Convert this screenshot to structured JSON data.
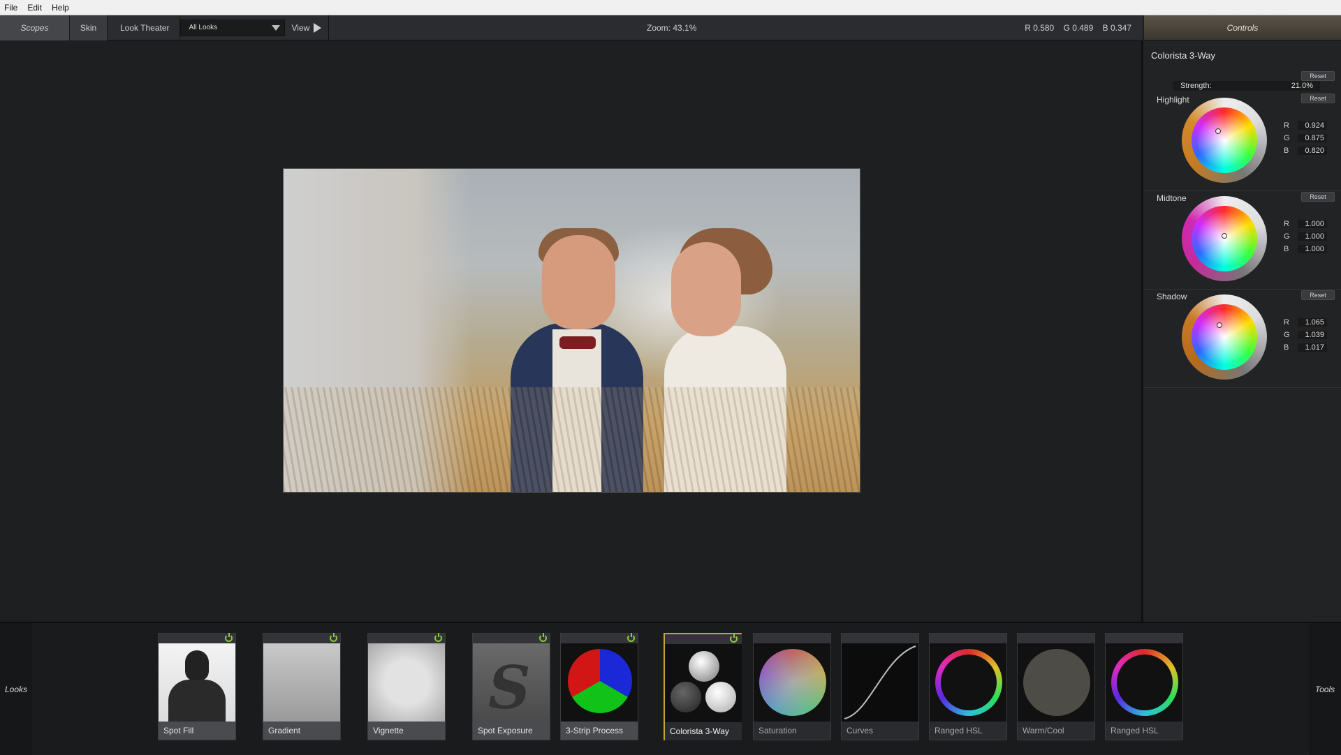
{
  "menu": {
    "items": [
      "File",
      "Edit",
      "Help"
    ]
  },
  "toolbar": {
    "scopes": "Scopes",
    "skin": "Skin",
    "look_theater": "Look Theater",
    "looks_select": "All Looks",
    "view": "View",
    "zoom": "Zoom:  43.1%",
    "r": "R 0.580",
    "g": "G 0.489",
    "b": "B 0.347"
  },
  "controls": {
    "header": "Controls",
    "title": "Colorista 3-Way",
    "reset": "Reset",
    "strength_label": "Strength:",
    "strength_value": "21.0%",
    "highlight": {
      "label": "Highlight",
      "r": "0.924",
      "g": "0.875",
      "b": "0.820"
    },
    "midtone": {
      "label": "Midtone",
      "r": "1.000",
      "g": "1.000",
      "b": "1.000"
    },
    "shadow": {
      "label": "Shadow",
      "r": "1.065",
      "g": "1.039",
      "b": "1.017"
    },
    "keys": {
      "r": "R",
      "g": "G",
      "b": "B"
    }
  },
  "lookbar": {
    "left_label": "Looks",
    "right_label": "Tools",
    "tiles": [
      {
        "name": "Spot Fill"
      },
      {
        "name": "Gradient"
      },
      {
        "name": "Vignette"
      },
      {
        "name": "Spot Exposure"
      },
      {
        "name": "3-Strip Process"
      },
      {
        "name": "Colorista 3-Way"
      },
      {
        "name": "Saturation"
      },
      {
        "name": "Curves"
      },
      {
        "name": "Ranged HSL"
      },
      {
        "name": "Warm/Cool"
      },
      {
        "name": "Ranged HSL"
      }
    ]
  },
  "colors": {
    "accent": "#caa23b",
    "power": "#8acb3c",
    "panel": "#222325"
  }
}
